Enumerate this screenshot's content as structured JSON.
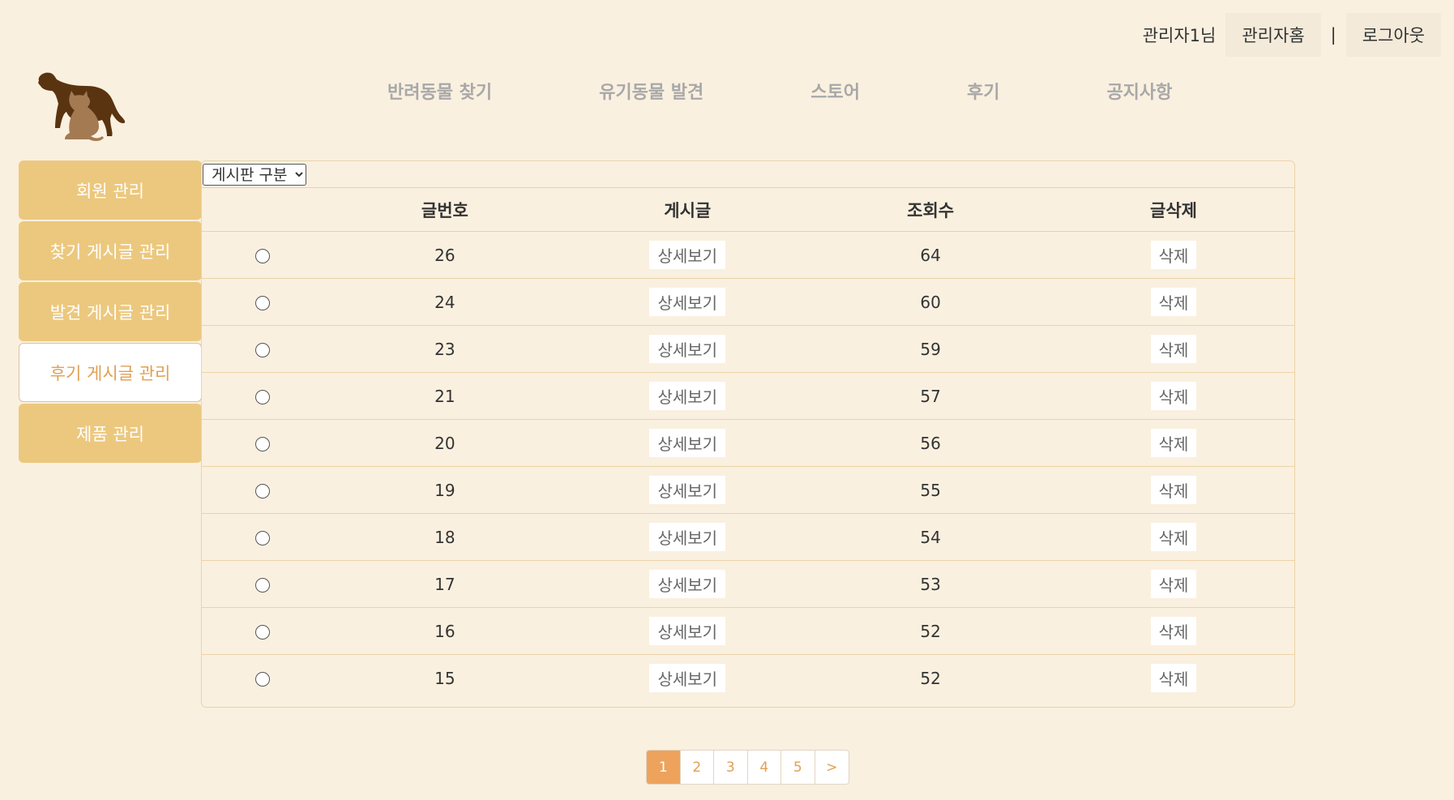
{
  "header": {
    "user_name": "관리자1님",
    "admin_home_label": "관리자홈",
    "separator": "|",
    "logout_label": "로그아웃"
  },
  "nav": {
    "items": [
      {
        "label": "반려동물 찾기"
      },
      {
        "label": "유기동물 발견"
      },
      {
        "label": "스토어"
      },
      {
        "label": "후기"
      },
      {
        "label": "공지사항"
      }
    ]
  },
  "sidebar": {
    "items": [
      {
        "label": "회원 관리"
      },
      {
        "label": "찾기 게시글 관리"
      },
      {
        "label": "발견 게시글 관리"
      },
      {
        "label": "후기 게시글 관리"
      },
      {
        "label": "제품 관리"
      }
    ],
    "active_index": 3
  },
  "board": {
    "select_label": "게시판 구분",
    "columns": [
      "",
      "글번호",
      "게시글",
      "조회수",
      "글삭제"
    ],
    "detail_label": "상세보기",
    "delete_label": "삭제",
    "rows": [
      {
        "no": "26",
        "views": "64"
      },
      {
        "no": "24",
        "views": "60"
      },
      {
        "no": "23",
        "views": "59"
      },
      {
        "no": "21",
        "views": "57"
      },
      {
        "no": "20",
        "views": "56"
      },
      {
        "no": "19",
        "views": "55"
      },
      {
        "no": "18",
        "views": "54"
      },
      {
        "no": "17",
        "views": "53"
      },
      {
        "no": "16",
        "views": "52"
      },
      {
        "no": "15",
        "views": "52"
      }
    ]
  },
  "pagination": {
    "pages": [
      "1",
      "2",
      "3",
      "4",
      "5",
      ">"
    ],
    "current": "1"
  },
  "colors": {
    "background": "#faf0e0",
    "sidebar": "#ecc87e",
    "accent": "#eda35c",
    "dog": "#5a3410",
    "cat": "#a47a52"
  }
}
